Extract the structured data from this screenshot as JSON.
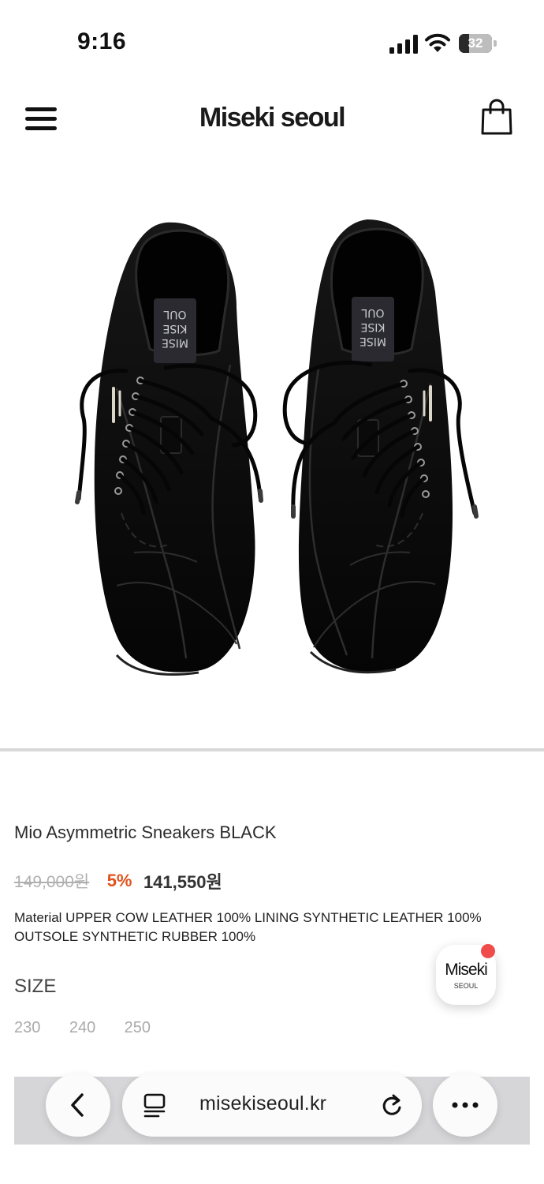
{
  "status_bar": {
    "time": "9:16",
    "battery_level": "32",
    "battery_fraction": 0.32
  },
  "header": {
    "brand": "Miseki seoul",
    "menu_icon": "hamburger-menu-icon",
    "cart_icon": "shopping-bag-icon"
  },
  "product": {
    "name": "Mio Asymmetric Sneakers BLACK",
    "price_original": "149,000원",
    "discount": "5%",
    "price_final": "141,550원",
    "material": "Material UPPER COW LEATHER 100% LINING SYNTHETIC LEATHER 100% OUTSOLE SYNTHETIC RUBBER 100%",
    "size_heading": "SIZE",
    "sizes": [
      "230",
      "240",
      "250"
    ],
    "shoe_insole_label": [
      "MISE",
      "KISE",
      "OUL"
    ]
  },
  "chat_badge": {
    "title": "Miseki",
    "subtitle": "SEOUL",
    "dot_color": "#ef4b4b"
  },
  "browser": {
    "url": "misekiseoul.kr",
    "back_icon": "chevron-left-icon",
    "tabs_icon": "reader-icon",
    "reload_icon": "reload-icon",
    "more_icon": "ellipsis-icon"
  },
  "colors": {
    "discount": "#e0531f",
    "strikethrough_price": "#b0b0b0",
    "shoe": "#0c0c0c"
  }
}
